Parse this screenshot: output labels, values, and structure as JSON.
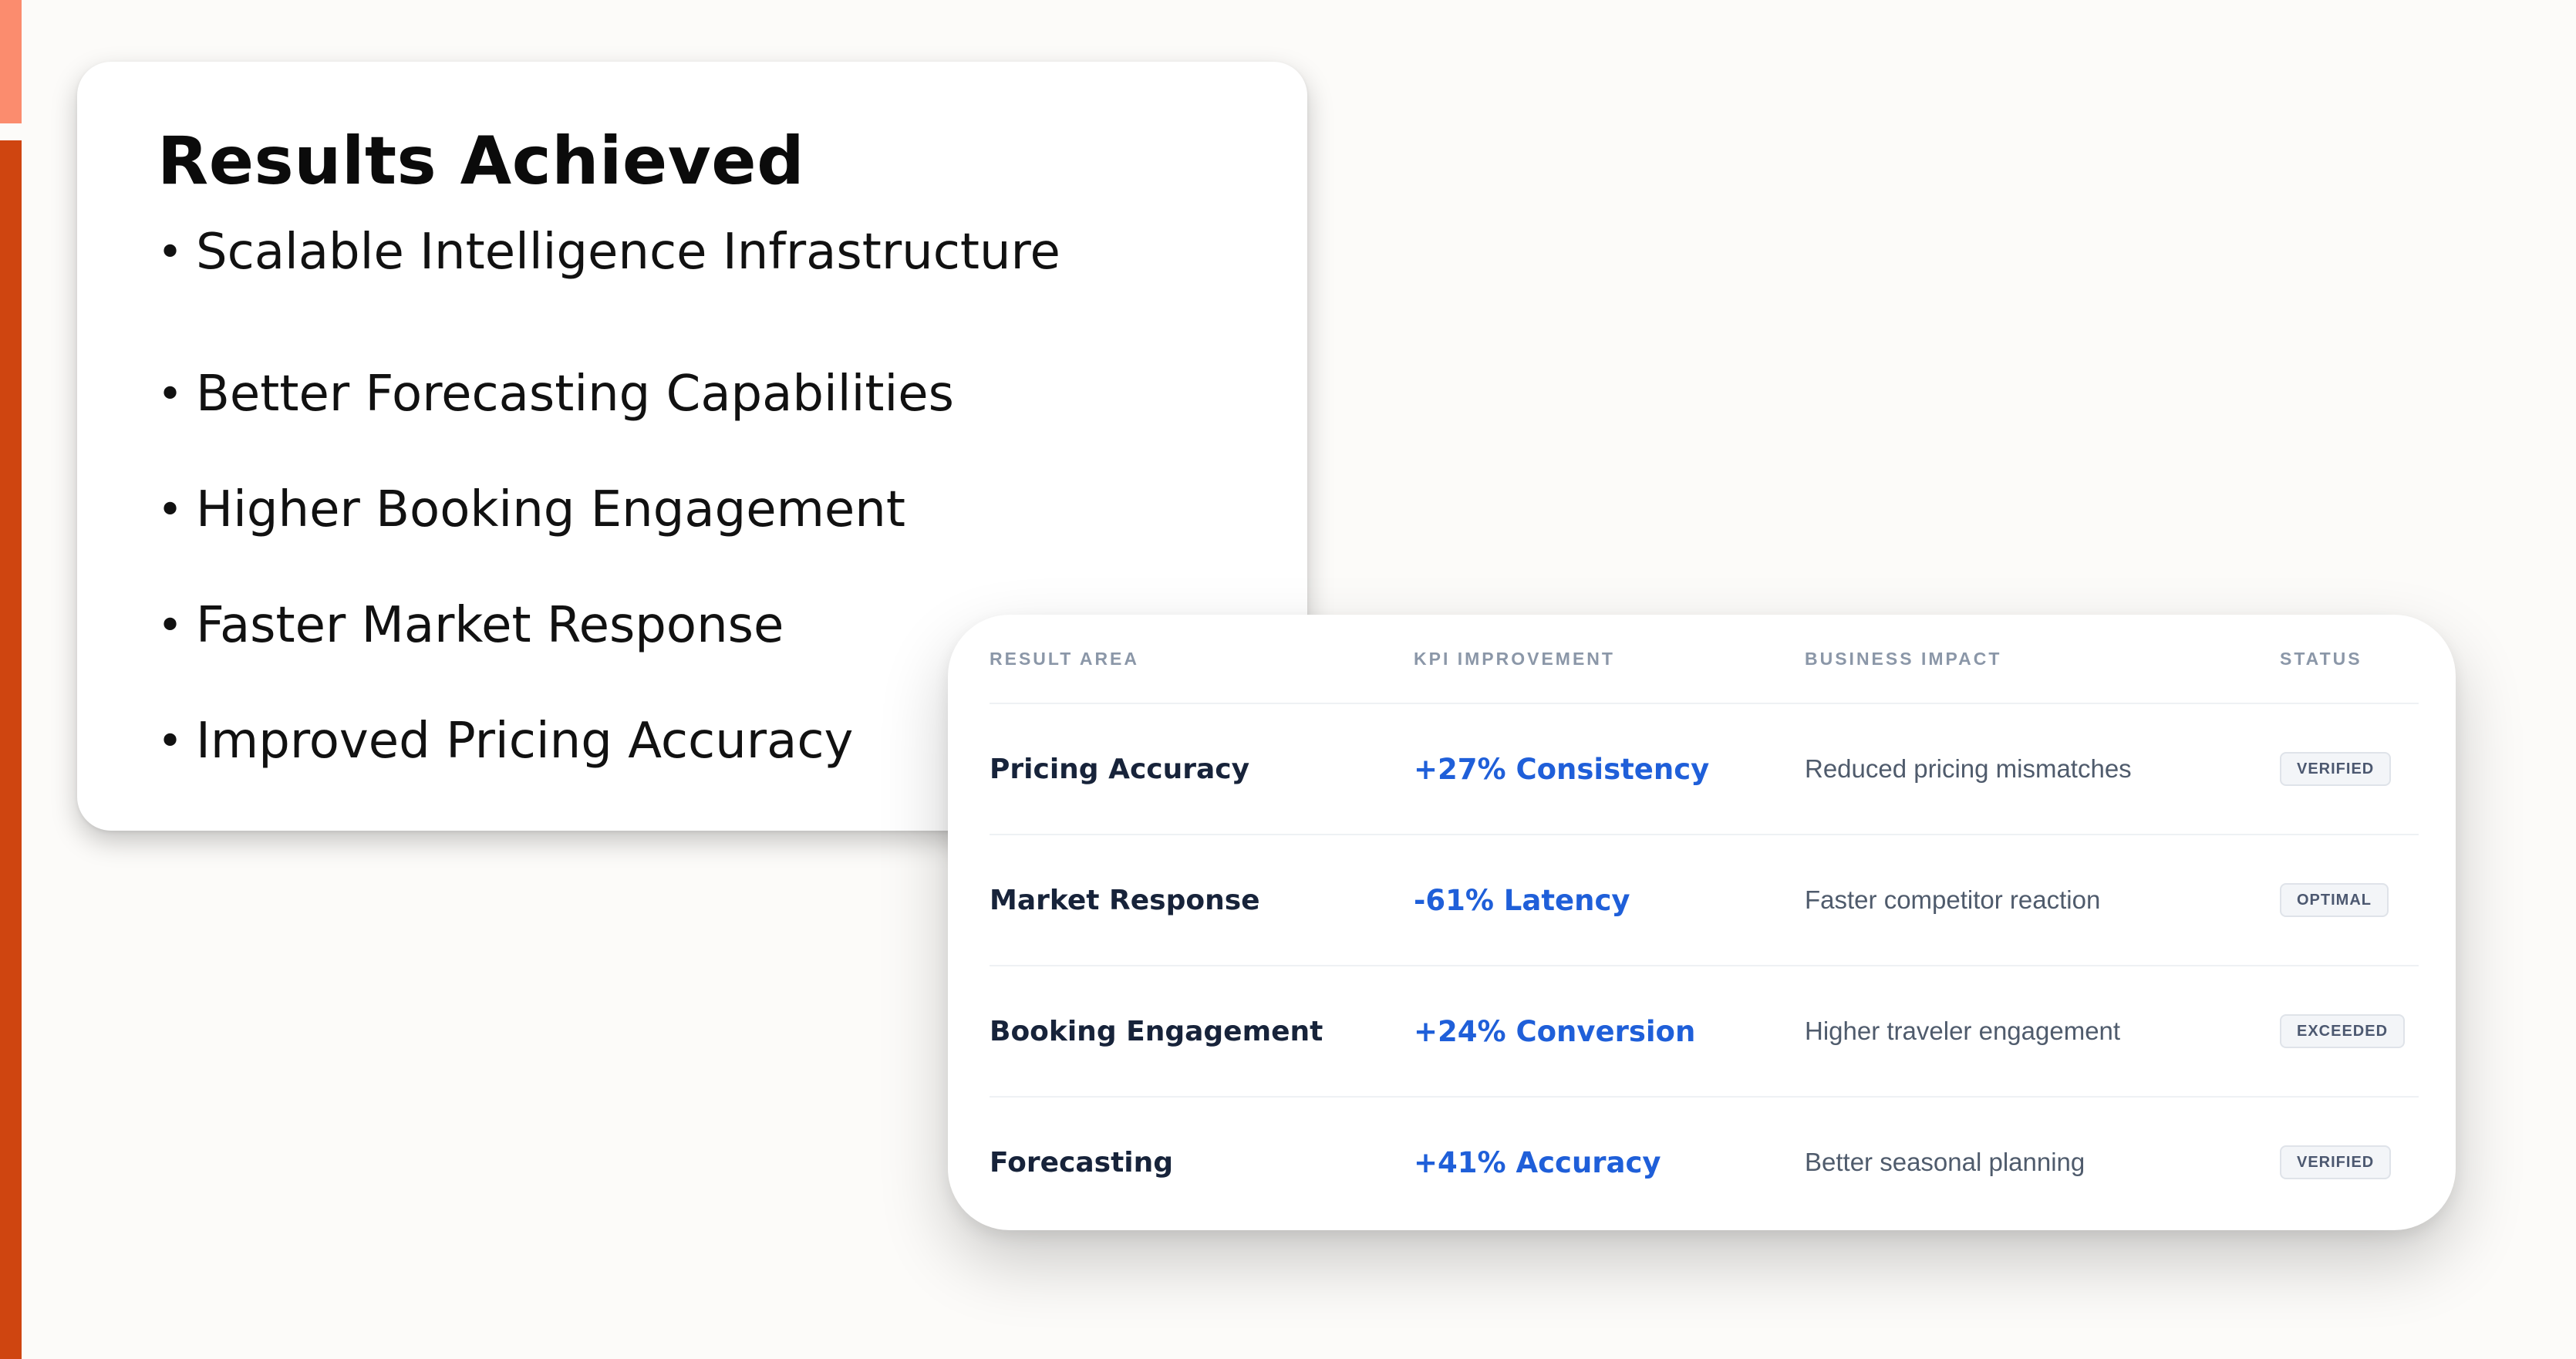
{
  "colors": {
    "accent_bar_top": "#fb8c6e",
    "accent_bar_main": "#cf4510",
    "kpi_text": "#1f5fd9"
  },
  "results": {
    "title": "Results Achieved",
    "items": [
      "Scalable Intelligence Infrastructure",
      "Better Forecasting Capabilities",
      "Higher Booking Engagement",
      "Faster Market Response",
      "Improved Pricing Accuracy"
    ]
  },
  "table": {
    "headers": {
      "area": "RESULT AREA",
      "kpi": "KPI IMPROVEMENT",
      "impact": "BUSINESS IMPACT",
      "status": "STATUS"
    },
    "rows": [
      {
        "area": "Pricing Accuracy",
        "kpi": "+27% Consistency",
        "impact": "Reduced pricing mismatches",
        "status": "VERIFIED"
      },
      {
        "area": "Market Response",
        "kpi": "-61% Latency",
        "impact": "Faster competitor reaction",
        "status": "OPTIMAL"
      },
      {
        "area": "Booking Engagement",
        "kpi": "+24% Conversion",
        "impact": "Higher traveler engagement",
        "status": "EXCEEDED"
      },
      {
        "area": "Forecasting",
        "kpi": "+41% Accuracy",
        "impact": "Better seasonal planning",
        "status": "VERIFIED"
      }
    ]
  }
}
